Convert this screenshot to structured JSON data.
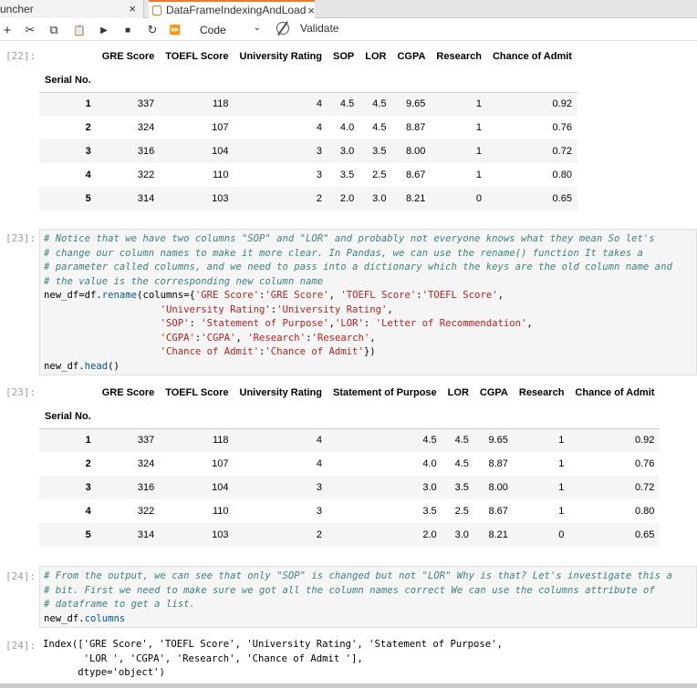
{
  "tabs": [
    {
      "label": "uncher",
      "close": "×"
    },
    {
      "label": "DataFrameIndexingAndLoad",
      "close": "×"
    }
  ],
  "toolbar": {
    "add": "+",
    "cut": "✂",
    "copy": "⧉",
    "paste": "📋",
    "run": "▶",
    "stop": "■",
    "restart": "↻",
    "run_all": "⏩",
    "cell_type": "Code",
    "validate": "Validate"
  },
  "cells": {
    "out22_prompt": "[22]:",
    "in23_prompt": "[23]:",
    "out23_prompt": "[23]:",
    "in24_prompt": "[24]:",
    "out24_prompt": "[24]:"
  },
  "table1": {
    "index_name": "Serial No.",
    "columns": [
      "GRE Score",
      "TOEFL Score",
      "University Rating",
      "SOP",
      "LOR",
      "CGPA",
      "Research",
      "Chance of Admit"
    ],
    "rows": [
      [
        "1",
        "337",
        "118",
        "4",
        "4.5",
        "4.5",
        "9.65",
        "1",
        "0.92"
      ],
      [
        "2",
        "324",
        "107",
        "4",
        "4.0",
        "4.5",
        "8.87",
        "1",
        "0.76"
      ],
      [
        "3",
        "316",
        "104",
        "3",
        "3.0",
        "3.5",
        "8.00",
        "1",
        "0.72"
      ],
      [
        "4",
        "322",
        "110",
        "3",
        "3.5",
        "2.5",
        "8.67",
        "1",
        "0.80"
      ],
      [
        "5",
        "314",
        "103",
        "2",
        "2.0",
        "3.0",
        "8.21",
        "0",
        "0.65"
      ]
    ]
  },
  "table2": {
    "index_name": "Serial No.",
    "columns": [
      "GRE Score",
      "TOEFL Score",
      "University Rating",
      "Statement of Purpose",
      "LOR",
      "CGPA",
      "Research",
      "Chance of Admit"
    ],
    "rows": [
      [
        "1",
        "337",
        "118",
        "4",
        "4.5",
        "4.5",
        "9.65",
        "1",
        "0.92"
      ],
      [
        "2",
        "324",
        "107",
        "4",
        "4.0",
        "4.5",
        "8.87",
        "1",
        "0.76"
      ],
      [
        "3",
        "316",
        "104",
        "3",
        "3.0",
        "3.5",
        "8.00",
        "1",
        "0.72"
      ],
      [
        "4",
        "322",
        "110",
        "3",
        "3.5",
        "2.5",
        "8.67",
        "1",
        "0.80"
      ],
      [
        "5",
        "314",
        "103",
        "2",
        "2.0",
        "3.0",
        "8.21",
        "0",
        "0.65"
      ]
    ]
  },
  "code23": {
    "line1": "# Notice that we have two columns \"SOP\" and \"LOR\" and probably not everyone knows what they mean So let's",
    "line2": "# change our column names to make it more clear. In Pandas, we can use the rename() function It takes a",
    "line3": "# parameter called columns, and we need to pass into a dictionary which the keys are the old column name and",
    "line4": "# the value is the corresponding new column name",
    "line5a": "new_df=df.",
    "line5b": "rename",
    "line5c": "(columns={",
    "line5d": "'GRE Score'",
    "line5e": ":",
    "line5f": "'GRE Score'",
    "line5g": ", ",
    "line5h": "'TOEFL Score'",
    "line5i": ":",
    "line5j": "'TOEFL Score'",
    "line5k": ",",
    "line6a": "                    ",
    "line6b": "'University Rating'",
    "line6c": ":",
    "line6d": "'University Rating'",
    "line6e": ",",
    "line7b": "'SOP'",
    "line7c": ": ",
    "line7d": "'Statement of Purpose'",
    "line7e": ",",
    "line7f": "'LOR'",
    "line7g": ": ",
    "line7h": "'Letter of Recommendation'",
    "line7i": ",",
    "line8b": "'CGPA'",
    "line8c": ":",
    "line8d": "'CGPA'",
    "line8e": ", ",
    "line8f": "'Research'",
    "line8g": ":",
    "line8h": "'Research'",
    "line8i": ",",
    "line9b": "'Chance of Admit'",
    "line9c": ":",
    "line9d": "'Chance of Admit'",
    "line9e": "})",
    "line10a": "new_df.",
    "line10b": "head",
    "line10c": "()"
  },
  "code24": {
    "line1": "# From the output, we can see that only \"SOP\" is changed but not \"LOR\" Why is that? Let's investigate this a",
    "line2": "# bit. First we need to make sure we got all the column names correct We can use the columns attribute of",
    "line3": "# dataframe to get a list.",
    "line4a": "new_df.",
    "line4b": "columns"
  },
  "output24": {
    "line1": "Index(['GRE Score', 'TOEFL Score', 'University Rating', 'Statement of Purpose',",
    "line2": "       'LOR ', 'CGPA', 'Research', 'Chance of Admit '],",
    "line3": "      dtype='object')"
  }
}
